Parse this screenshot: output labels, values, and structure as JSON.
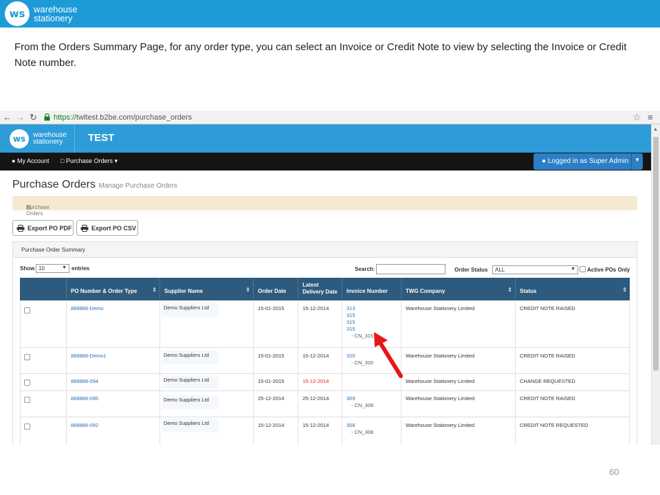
{
  "slide": {
    "logo_mark": "ws",
    "logo_line1": "warehouse",
    "logo_line2": "stationery",
    "description": "From the Orders Summary Page, for any order type, you can select an Invoice or Credit Note to view by selecting the Invoice or Credit Note number.",
    "page_number": "60"
  },
  "browser": {
    "url_https": "https://",
    "url_rest": "twltest.b2be.com/purchase_orders"
  },
  "app": {
    "title": "TEST",
    "nav_my_account": "My Account",
    "nav_purchase_orders": "Purchase Orders",
    "logged_in": "Logged in as Super Admin",
    "page_title": "Purchase Orders",
    "page_subtitle": "Manage Purchase Orders",
    "breadcrumb": "Purchase Orders",
    "export_pdf": "Export PO PDF",
    "export_csv": "Export PO CSV",
    "panel_title": "Purchase Order Summary",
    "show_label": "Show",
    "show_value": "10",
    "entries_label": "entries",
    "search_label": "Search:",
    "order_status_label": "Order Status",
    "order_status_value": "ALL",
    "active_pos_label": "Active POs Only"
  },
  "table": {
    "headers": {
      "po": "PO Number & Order Type",
      "supplier": "Supplier Name",
      "order_date": "Order Date",
      "latest_delivery_1": "Latest",
      "latest_delivery_2": "Delivery Date",
      "invoice": "Invoice Number",
      "company": "TWG Company",
      "status": "Status"
    },
    "rows": [
      {
        "po": "888888-Demo",
        "supplier": "Demo Suppliers Ltd",
        "order_date": "15-01-2015",
        "delivery": "15-12-2014",
        "invoices": [
          "313",
          "315",
          "315",
          "315"
        ],
        "credit_note": "- CN_315",
        "company": "Warehouse Stationery Limited",
        "status": "CREDIT NOTE RAISED"
      },
      {
        "po": "888888-Demo1",
        "supplier": "Demo Suppliers Ltd",
        "order_date": "15-01-2015",
        "delivery": "15-12-2014",
        "invoices": [
          "320"
        ],
        "credit_note": "- CN_320",
        "company": "Warehouse Stationery Limited",
        "status": "CREDIT NOTE RAISED"
      },
      {
        "po": "888888-094",
        "supplier": "Demo Suppliers Ltd",
        "order_date": "15-01-2015",
        "delivery": "15-12-2014",
        "invoices": [],
        "credit_note": "",
        "company": "Warehouse Stationery Limited",
        "status": "CHANGE REQUESTED"
      },
      {
        "po": "888888-095",
        "supplier": "Demo Suppliers Ltd",
        "order_date": "25-12-2014",
        "delivery": "25-12-2014",
        "invoices": [
          "309"
        ],
        "credit_note": "- CN_309",
        "company": "Warehouse Stationery Limited",
        "status": "CREDIT NOTE RAISED"
      },
      {
        "po": "888888-092",
        "supplier": "Demo Suppliers Ltd",
        "order_date": "15-12-2014",
        "delivery": "15-12-2014",
        "invoices": [
          "308"
        ],
        "credit_note": "- CN_308",
        "company": "Warehouse Stationery Limited",
        "status": "CREDIT NOTE REQUESTED"
      }
    ]
  },
  "colors": {
    "slide_header": "#1d9bd8",
    "app_header": "#2e9cd9",
    "table_header": "#2d5a7d",
    "highlight_arrow": "#e8151b",
    "overdue_date": "#dd2222"
  }
}
